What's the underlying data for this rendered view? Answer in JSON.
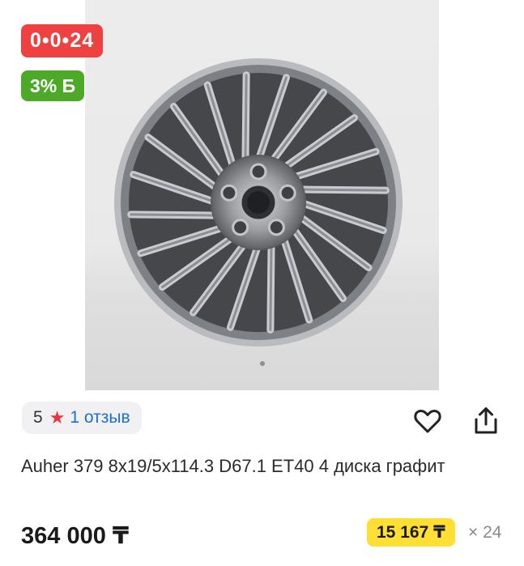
{
  "product": {
    "title": "Auher 379 8x19/5x114.3 D67.1 ET40 4 диска графит",
    "price": "364 000 ₸",
    "image_alt": "wheel-rim-photo",
    "gallery": {
      "dots": 1,
      "active": 1
    }
  },
  "badges": {
    "sale": "0•0•24",
    "bonus": "3% Б"
  },
  "rating": {
    "score": "5",
    "star_icon": "★",
    "reviews": "1 отзыв"
  },
  "actions": {
    "favorite_icon": "heart-icon",
    "share_icon": "share-icon"
  },
  "installment": {
    "monthly": "15 167 ₸",
    "months": "× 24"
  },
  "colors": {
    "sale": "#ef4141",
    "bonus": "#4caa28",
    "installment": "#ffdf33",
    "link": "#1c6fd8",
    "star": "#e8363c"
  }
}
